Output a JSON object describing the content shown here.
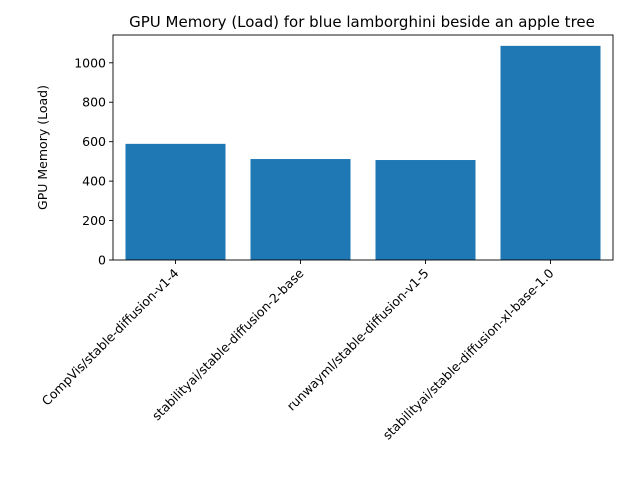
{
  "chart_data": {
    "type": "bar",
    "title": "GPU Memory (Load) for blue lamborghini beside an apple tree",
    "xlabel": "",
    "ylabel": "GPU Memory (Load)",
    "categories": [
      "CompVis/stable-diffusion-v1-4",
      "stabilityai/stable-diffusion-2-base",
      "runwayml/stable-diffusion-v1-5",
      "stabilityai/stable-diffusion-xl-base-1.0"
    ],
    "values": [
      589,
      512,
      507,
      1086
    ],
    "ylim": [
      0,
      1141
    ],
    "yticks": [
      0,
      200,
      400,
      600,
      800,
      1000
    ],
    "grid": false,
    "bar_color": "#1f77b4"
  }
}
